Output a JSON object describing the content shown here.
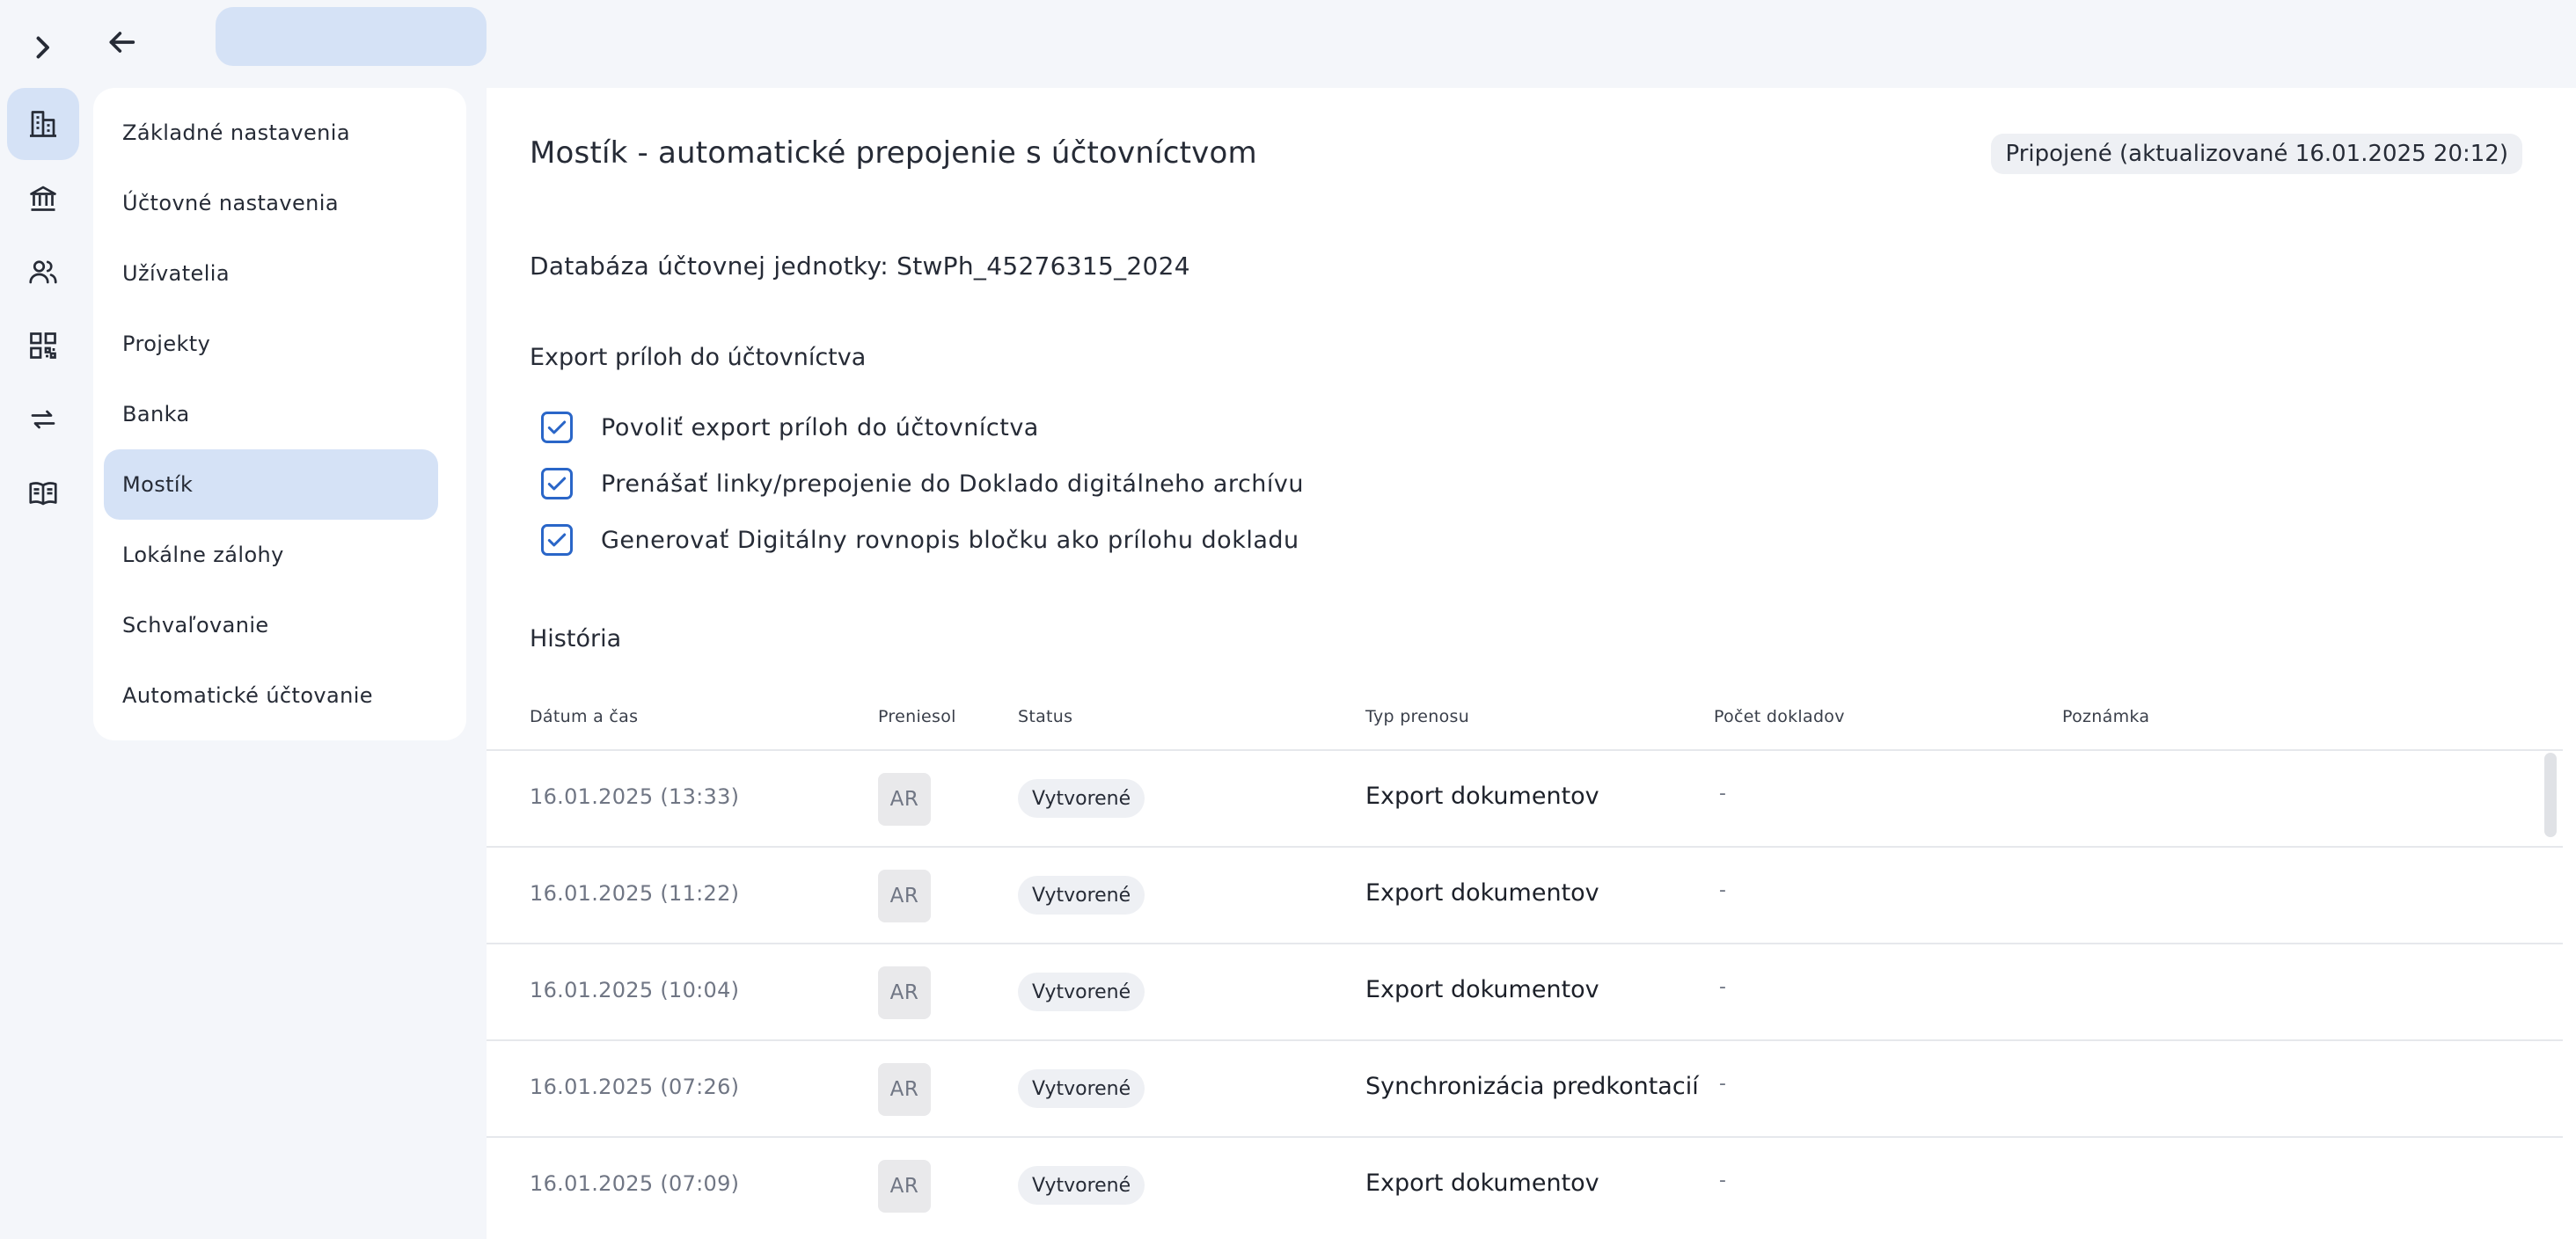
{
  "rail": {
    "items": [
      {
        "icon": "building-icon",
        "active": true
      },
      {
        "icon": "bank-icon",
        "active": false
      },
      {
        "icon": "users-icon",
        "active": false
      },
      {
        "icon": "qr-code-icon",
        "active": false
      },
      {
        "icon": "transfer-arrows-icon",
        "active": false
      },
      {
        "icon": "book-icon",
        "active": false
      }
    ]
  },
  "menu": {
    "items": [
      {
        "label": "Základné nastavenia"
      },
      {
        "label": "Účtovné nastavenia"
      },
      {
        "label": "Užívatelia"
      },
      {
        "label": "Projekty"
      },
      {
        "label": "Banka"
      },
      {
        "label": "Mostík"
      },
      {
        "label": "Lokálne zálohy"
      },
      {
        "label": "Schvaľovanie"
      },
      {
        "label": "Automatické účtovanie"
      }
    ],
    "active": "Mostík"
  },
  "main": {
    "title": "Mostík - automatické prepojenie s účtovníctvom",
    "connection_status": "Pripojené (aktualizované 16.01.2025 20:12)",
    "database_label": "Databáza účtovnej jednotky: StwPh_45276315_2024",
    "export_section_title": "Export príloh do účtovníctva",
    "checkboxes": [
      {
        "label": "Povoliť export príloh do účtovníctva",
        "checked": true
      },
      {
        "label": "Prenášať linky/prepojenie do Doklado digitálneho archívu",
        "checked": true
      },
      {
        "label": "Generovať Digitálny rovnopis bločku ako prílohu dokladu",
        "checked": true
      }
    ],
    "history_title": "História"
  },
  "table": {
    "headers": {
      "date": "Dátum a čas",
      "by": "Preniesol",
      "status": "Status",
      "type": "Typ prenosu",
      "count": "Počet dokladov",
      "note": "Poznámka"
    },
    "rows": [
      {
        "date": "16.01.2025 (13:33)",
        "by": "AR",
        "status": "Vytvorené",
        "type": "Export dokumentov",
        "count": "-",
        "note": ""
      },
      {
        "date": "16.01.2025 (11:22)",
        "by": "AR",
        "status": "Vytvorené",
        "type": "Export dokumentov",
        "count": "-",
        "note": ""
      },
      {
        "date": "16.01.2025 (10:04)",
        "by": "AR",
        "status": "Vytvorené",
        "type": "Export dokumentov",
        "count": "-",
        "note": ""
      },
      {
        "date": "16.01.2025 (07:26)",
        "by": "AR",
        "status": "Vytvorené",
        "type": "Synchronizácia predkontacií",
        "count": "-",
        "note": ""
      },
      {
        "date": "16.01.2025 (07:09)",
        "by": "AR",
        "status": "Vytvorené",
        "type": "Export dokumentov",
        "count": "-",
        "note": ""
      }
    ]
  },
  "colors": {
    "accent": "#2a66c8",
    "active_bg": "#d5e2f6",
    "page_bg": "#f4f6fa"
  }
}
